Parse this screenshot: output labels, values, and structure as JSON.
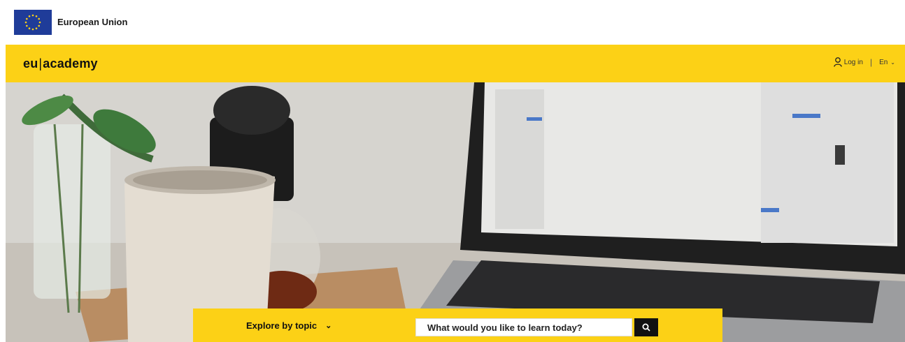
{
  "eu": {
    "label": "European Union",
    "flag_icon": "eu-flag-icon"
  },
  "header": {
    "brand_left": "eu",
    "brand_sep": "|",
    "brand_right": "academy",
    "login_label": "Log in",
    "separator": "|",
    "language": "En",
    "user_icon": "user-icon",
    "lang_chevron_icon": "chevron-down-icon"
  },
  "hero": {
    "image": "desk-with-laptop-cup-plant-photo"
  },
  "search": {
    "explore_label": "Explore by topic",
    "explore_chevron_icon": "chevron-down-icon",
    "input_value": "",
    "placeholder": "What would you like to learn today?",
    "search_icon": "search-icon"
  },
  "colors": {
    "brand_yellow": "#fcd116",
    "eu_blue": "#1f3c99",
    "search_button": "#111111"
  }
}
